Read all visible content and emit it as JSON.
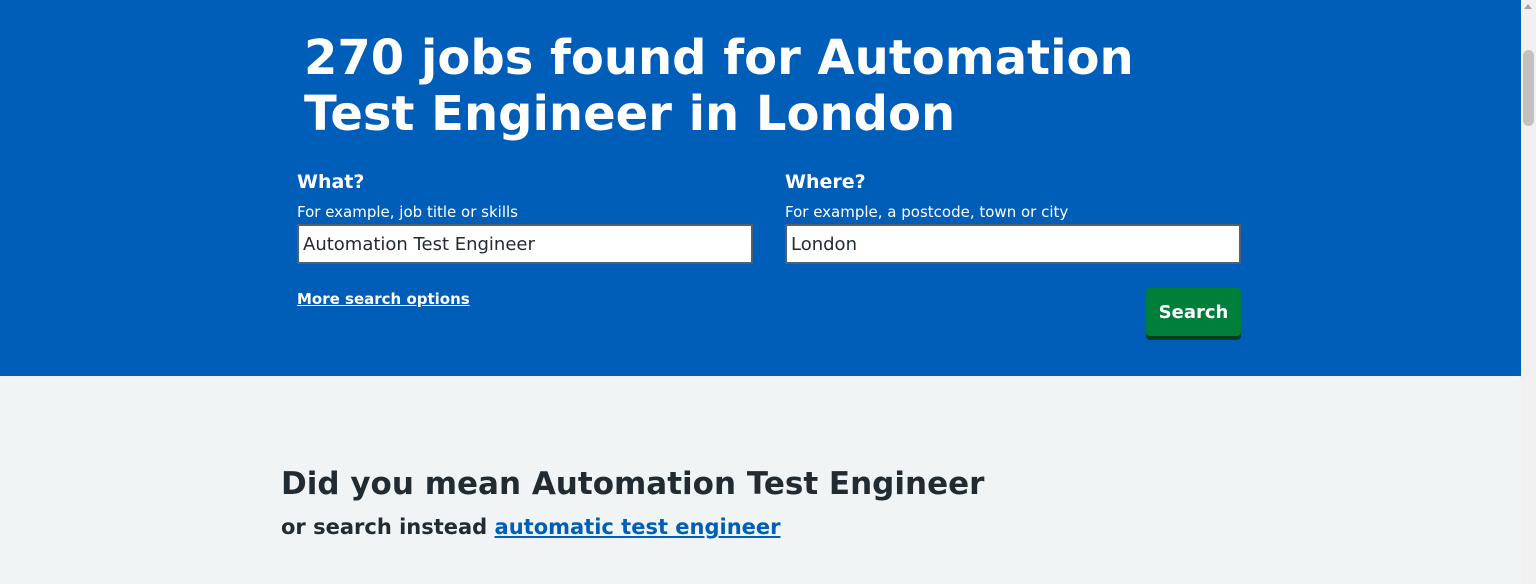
{
  "header": {
    "title": "270 jobs found for Automation Test Engineer in London"
  },
  "search": {
    "what_label": "What?",
    "what_hint": "For example, job title or skills",
    "what_value": "Automation Test Engineer",
    "where_label": "Where?",
    "where_hint": "For example, a postcode, town or city",
    "where_value": "London",
    "more_options_label": "More search options",
    "search_button_label": "Search"
  },
  "suggestion": {
    "heading": "Did you mean Automation Test Engineer",
    "prefix": "or search instead",
    "link_text": "automatic test engineer"
  },
  "colors": {
    "header_bg": "#005eb8",
    "button_green": "#007f3b",
    "page_bg": "#f0f4f5",
    "link_blue": "#005eb8"
  }
}
